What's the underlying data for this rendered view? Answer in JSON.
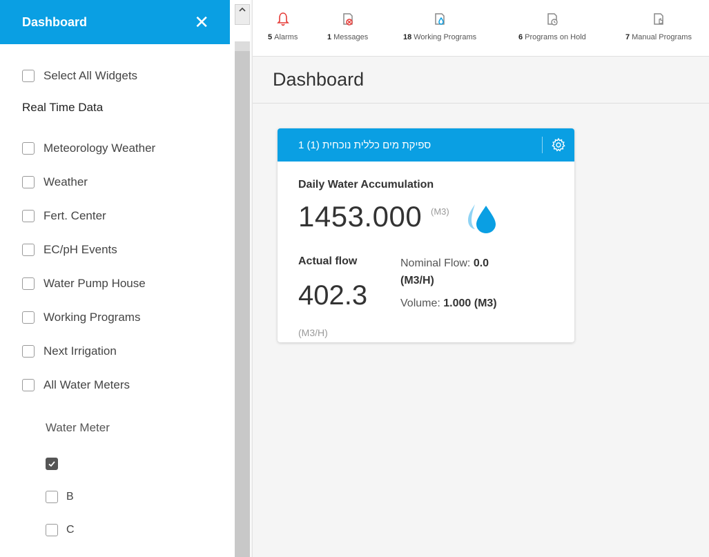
{
  "sidebar": {
    "title": "Dashboard",
    "close_label": "✕",
    "select_all": "Select All Widgets",
    "section_title": "Real Time Data",
    "items": [
      {
        "label": "Meteorology Weather"
      },
      {
        "label": "Weather"
      },
      {
        "label": "Fert. Center"
      },
      {
        "label": "EC/pH Events"
      },
      {
        "label": "Water Pump House"
      },
      {
        "label": "Working Programs"
      },
      {
        "label": "Next Irrigation"
      },
      {
        "label": "All Water Meters"
      }
    ],
    "water_meter_title": "Water Meter",
    "water_meters": [
      {
        "label": "",
        "checked": true
      },
      {
        "label": "B",
        "checked": false
      },
      {
        "label": "C",
        "checked": false
      }
    ]
  },
  "topbar": {
    "items": [
      {
        "count": "5",
        "label": "Alarms",
        "icon": "bell-icon",
        "color": "#e53935"
      },
      {
        "count": "1",
        "label": "Messages",
        "icon": "message-cancel-icon",
        "color": "#e53935"
      },
      {
        "count": "18",
        "label": "Working Programs",
        "icon": "program-drop-icon",
        "color": "#0a9fe3"
      },
      {
        "count": "6",
        "label": "Programs on Hold",
        "icon": "program-clock-icon",
        "color": "#888888"
      },
      {
        "count": "7",
        "label": "Manual Programs",
        "icon": "program-hand-icon",
        "color": "#888888"
      }
    ]
  },
  "page": {
    "title": "Dashboard"
  },
  "widget": {
    "header": "ספיקת מים כללית נוכחית (1) 1",
    "daily_label": "Daily Water Accumulation",
    "daily_value": "1453.000",
    "daily_unit": "(M3)",
    "actual_flow_label": "Actual flow",
    "actual_flow_value": "402.3",
    "actual_flow_unit": "(M3/H)",
    "nominal_label": "Nominal Flow:",
    "nominal_value": "0.0",
    "nominal_unit": "(M3/H)",
    "volume_label": "Volume:",
    "volume_value": "1.000 (M3)"
  },
  "colors": {
    "accent": "#0a9fe3",
    "alarm": "#e53935"
  }
}
